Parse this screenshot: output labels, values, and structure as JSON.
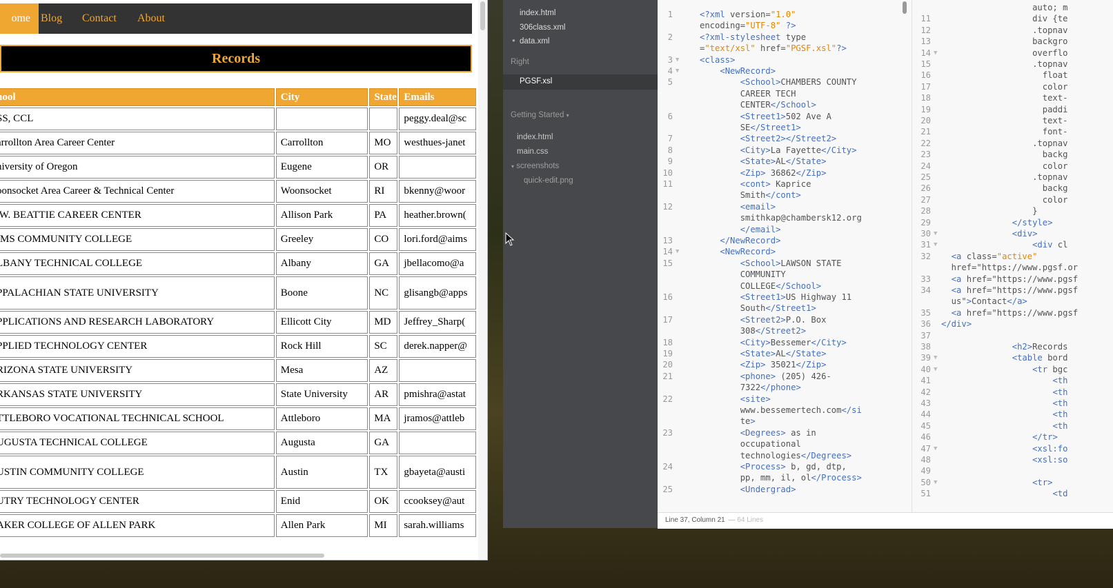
{
  "browser": {
    "nav": [
      "ome",
      "Blog",
      "Contact",
      "About"
    ],
    "heading": "Records",
    "columns": [
      "hool",
      "City",
      "State",
      "Emails"
    ],
    "rows": [
      [
        "SS, CCL",
        "",
        "",
        "peggy.deal@sc"
      ],
      [
        "arrollton Area Career Center",
        "Carrollton",
        "MO",
        "westhues-janet"
      ],
      [
        "niversity of Oregon",
        "Eugene",
        "OR",
        ""
      ],
      [
        "oonsocket Area Career & Technical Center",
        "Woonsocket",
        "RI",
        "bkenny@woor"
      ],
      [
        ".W. BEATTIE CAREER CENTER",
        "Allison Park",
        "PA",
        "heather.brown("
      ],
      [
        "IMS COMMUNITY COLLEGE",
        "Greeley",
        "CO",
        "lori.ford@aims"
      ],
      [
        "LBANY TECHNICAL COLLEGE",
        "Albany",
        "GA",
        "jbellacomo@a"
      ],
      [
        "PPALACHIAN STATE UNIVERSITY",
        "Boone",
        "NC",
        "glisangb@apps"
      ],
      [
        "PPLICATIONS AND RESEARCH LABORATORY",
        "Ellicott City",
        "MD",
        "Jeffrey_Sharp("
      ],
      [
        "PPLIED TECHNOLOGY CENTER",
        "Rock Hill",
        "SC",
        "derek.napper@"
      ],
      [
        "RIZONA STATE UNIVERSITY",
        "Mesa",
        "AZ",
        ""
      ],
      [
        "RKANSAS STATE UNIVERSITY",
        "State University",
        "AR",
        "pmishra@astat"
      ],
      [
        "TTLEBORO VOCATIONAL TECHNICAL SCHOOL",
        "Attleboro",
        "MA",
        "jramos@attleb"
      ],
      [
        "UGUSTA TECHNICAL COLLEGE",
        "Augusta",
        "GA",
        ""
      ],
      [
        "USTIN COMMUNITY COLLEGE",
        "Austin",
        "TX",
        "gbayeta@austi"
      ],
      [
        "UTRY TECHNOLOGY CENTER",
        "Enid",
        "OK",
        "ccooksey@aut"
      ],
      [
        "AKER COLLEGE OF ALLEN PARK",
        "Allen Park",
        "MI",
        "sarah.williams"
      ]
    ]
  },
  "sidebar": {
    "working_files": [
      "index.html",
      "306class.xml",
      "data.xml"
    ],
    "right_label": "Right",
    "right_files": [
      "PGSF.xsl"
    ],
    "project_label": "Getting Started",
    "project_files": [
      "index.html",
      "main.css"
    ],
    "folder": "screenshots",
    "folder_files": [
      "quick-edit.png"
    ]
  },
  "editor_left": {
    "lines": [
      {
        "n": "1",
        "t": "<?xml version=\"1.0\""
      },
      {
        "n": "",
        "t": "encoding=\"UTF-8\" ?>"
      },
      {
        "n": "2",
        "t": "<?xml-stylesheet type"
      },
      {
        "n": "",
        "t": "=\"text/xsl\" href=\"PGSF.xsl\"?>"
      },
      {
        "n": "3",
        "t": "<class>"
      },
      {
        "n": "4",
        "t": "    <NewRecord>"
      },
      {
        "n": "5",
        "t": "        <School>CHAMBERS COUNTY"
      },
      {
        "n": "",
        "t": "        CAREER TECH"
      },
      {
        "n": "",
        "t": "        CENTER</School>"
      },
      {
        "n": "6",
        "t": "        <Street1>502 Ave A"
      },
      {
        "n": "",
        "t": "        SE</Street1>"
      },
      {
        "n": "7",
        "t": "        <Street2></Street2>"
      },
      {
        "n": "8",
        "t": "        <City>La Fayette</City>"
      },
      {
        "n": "9",
        "t": "        <State>AL</State>"
      },
      {
        "n": "10",
        "t": "        <Zip> 36862</Zip>"
      },
      {
        "n": "11",
        "t": "        <cont> Kaprice"
      },
      {
        "n": "",
        "t": "        Smith</cont>"
      },
      {
        "n": "12",
        "t": "        <email>"
      },
      {
        "n": "",
        "t": "        smithkap@chambersk12.org"
      },
      {
        "n": "",
        "t": "        </email>"
      },
      {
        "n": "13",
        "t": "    </NewRecord>"
      },
      {
        "n": "14",
        "t": "    <NewRecord>"
      },
      {
        "n": "15",
        "t": "        <School>LAWSON STATE"
      },
      {
        "n": "",
        "t": "        COMMUNITY"
      },
      {
        "n": "",
        "t": "        COLLEGE</School>"
      },
      {
        "n": "16",
        "t": "        <Street1>US Highway 11"
      },
      {
        "n": "",
        "t": "        South</Street1>"
      },
      {
        "n": "17",
        "t": "        <Street2>P.O. Box"
      },
      {
        "n": "",
        "t": "        308</Street2>"
      },
      {
        "n": "18",
        "t": "        <City>Bessemer</City>"
      },
      {
        "n": "19",
        "t": "        <State>AL</State>"
      },
      {
        "n": "20",
        "t": "        <Zip> 35021</Zip>"
      },
      {
        "n": "21",
        "t": "        <phone> (205) 426-"
      },
      {
        "n": "",
        "t": "        7322</phone>"
      },
      {
        "n": "22",
        "t": "        <site>"
      },
      {
        "n": "",
        "t": "        www.bessemertech.com</si"
      },
      {
        "n": "",
        "t": "        te>"
      },
      {
        "n": "23",
        "t": "        <Degrees> as in"
      },
      {
        "n": "",
        "t": "        occupational"
      },
      {
        "n": "",
        "t": "        technologies</Degrees>"
      },
      {
        "n": "24",
        "t": "        <Process> b, gd, dtp,"
      },
      {
        "n": "",
        "t": "        pp, mm, il, ol</Process>"
      },
      {
        "n": "25",
        "t": "        <Undergrad>"
      }
    ]
  },
  "editor_right": {
    "lines": [
      {
        "n": "",
        "t": "                  auto; m"
      },
      {
        "n": "11",
        "t": "                  div {te"
      },
      {
        "n": "12",
        "t": "                  .topnav"
      },
      {
        "n": "13",
        "t": "                  backgro"
      },
      {
        "n": "14",
        "t": "                  overflo"
      },
      {
        "n": "15",
        "t": "                  .topnav"
      },
      {
        "n": "16",
        "t": "                    float"
      },
      {
        "n": "17",
        "t": "                    color"
      },
      {
        "n": "18",
        "t": "                    text-"
      },
      {
        "n": "19",
        "t": "                    paddi"
      },
      {
        "n": "20",
        "t": "                    text-"
      },
      {
        "n": "21",
        "t": "                    font-"
      },
      {
        "n": "22",
        "t": "                  .topnav"
      },
      {
        "n": "23",
        "t": "                    backg"
      },
      {
        "n": "24",
        "t": "                    color"
      },
      {
        "n": "25",
        "t": "                  .topnav"
      },
      {
        "n": "26",
        "t": "                    backg"
      },
      {
        "n": "27",
        "t": "                    color"
      },
      {
        "n": "28",
        "t": "                  }"
      },
      {
        "n": "29",
        "t": "              </style>"
      },
      {
        "n": "30",
        "t": "              <div>"
      },
      {
        "n": "31",
        "t": "                  <div cl"
      },
      {
        "n": "32",
        "t": "  <a class=\"active\""
      },
      {
        "n": "",
        "t": "  href=\"https://www.pgsf.or"
      },
      {
        "n": "33",
        "t": "  <a href=\"https://www.pgsf"
      },
      {
        "n": "34",
        "t": "  <a href=\"https://www.pgsf"
      },
      {
        "n": "",
        "t": "  us\">Contact</a>"
      },
      {
        "n": "35",
        "t": "  <a href=\"https://www.pgsf"
      },
      {
        "n": "36",
        "t": "</div>"
      },
      {
        "n": "37",
        "t": ""
      },
      {
        "n": "38",
        "t": "              <h2>Records"
      },
      {
        "n": "39",
        "t": "              <table bord"
      },
      {
        "n": "40",
        "t": "                  <tr bgc"
      },
      {
        "n": "41",
        "t": "                      <th"
      },
      {
        "n": "42",
        "t": "                      <th"
      },
      {
        "n": "43",
        "t": "                      <th"
      },
      {
        "n": "44",
        "t": "                      <th"
      },
      {
        "n": "45",
        "t": "                      <th"
      },
      {
        "n": "46",
        "t": "                  </tr>"
      },
      {
        "n": "47",
        "t": "                  <xsl:fo"
      },
      {
        "n": "48",
        "t": "                  <xsl:so"
      },
      {
        "n": "49",
        "t": ""
      },
      {
        "n": "50",
        "t": "                  <tr>"
      },
      {
        "n": "51",
        "t": "                      <td"
      }
    ]
  },
  "status": {
    "position": "Line 37, Column 21",
    "lines": "64 Lines"
  }
}
